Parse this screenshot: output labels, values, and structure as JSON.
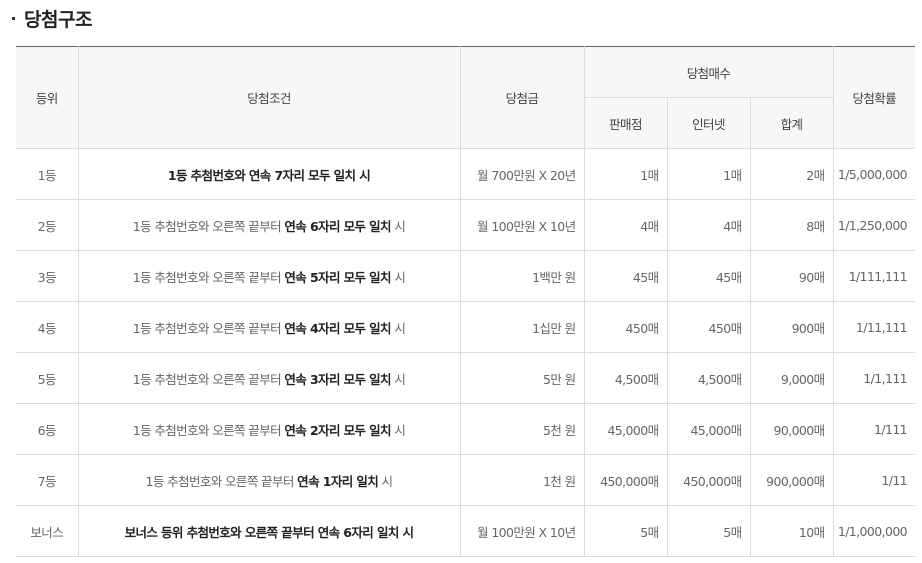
{
  "section_title": "당첨구조",
  "table": {
    "headers": {
      "rank": "등위",
      "condition": "당첨조건",
      "prize": "당첨금",
      "count_group": "당첨매수",
      "store": "판매점",
      "internet": "인터넷",
      "total": "합계",
      "probability": "당첨확률"
    },
    "rows": [
      {
        "rank": "1등",
        "cond_pre": "",
        "cond_bold": "1등 추첨번호와 연속 7자리 모두 일치 시",
        "cond_post": "",
        "prize": "월 700만원 X 20년",
        "store": "1매",
        "internet": "1매",
        "total": "2매",
        "probability": "1/5,000,000"
      },
      {
        "rank": "2등",
        "cond_pre": "1등 추첨번호와 오른쪽 끝부터 ",
        "cond_bold": "연속 6자리 모두 일치",
        "cond_post": " 시",
        "prize": "월 100만원 X 10년",
        "store": "4매",
        "internet": "4매",
        "total": "8매",
        "probability": "1/1,250,000"
      },
      {
        "rank": "3등",
        "cond_pre": "1등 추첨번호와 오른쪽 끝부터 ",
        "cond_bold": "연속 5자리 모두 일치",
        "cond_post": " 시",
        "prize": "1백만 원",
        "store": "45매",
        "internet": "45매",
        "total": "90매",
        "probability": "1/111,111"
      },
      {
        "rank": "4등",
        "cond_pre": "1등 추첨번호와 오른쪽 끝부터 ",
        "cond_bold": "연속 4자리 모두 일치",
        "cond_post": " 시",
        "prize": "1십만 원",
        "store": "450매",
        "internet": "450매",
        "total": "900매",
        "probability": "1/11,111"
      },
      {
        "rank": "5등",
        "cond_pre": "1등 추첨번호와 오른쪽 끝부터 ",
        "cond_bold": "연속 3자리 모두 일치",
        "cond_post": " 시",
        "prize": "5만 원",
        "store": "4,500매",
        "internet": "4,500매",
        "total": "9,000매",
        "probability": "1/1,111"
      },
      {
        "rank": "6등",
        "cond_pre": "1등 추첨번호와 오른쪽 끝부터 ",
        "cond_bold": "연속 2자리 모두 일치",
        "cond_post": " 시",
        "prize": "5천 원",
        "store": "45,000매",
        "internet": "45,000매",
        "total": "90,000매",
        "probability": "1/111"
      },
      {
        "rank": "7등",
        "cond_pre": "1등 추첨번호와 오른쪽 끝부터 ",
        "cond_bold": "연속 1자리 일치",
        "cond_post": " 시",
        "prize": "1천 원",
        "store": "450,000매",
        "internet": "450,000매",
        "total": "900,000매",
        "probability": "1/11"
      },
      {
        "rank": "보너스",
        "cond_pre": "",
        "cond_bold": "보너스 등위 추첨번호와 오른쪽 끝부터 연속 6자리 일치 시",
        "cond_post": "",
        "prize": "월 100만원 X 10년",
        "store": "5매",
        "internet": "5매",
        "total": "10매",
        "probability": "1/1,000,000"
      }
    ]
  }
}
